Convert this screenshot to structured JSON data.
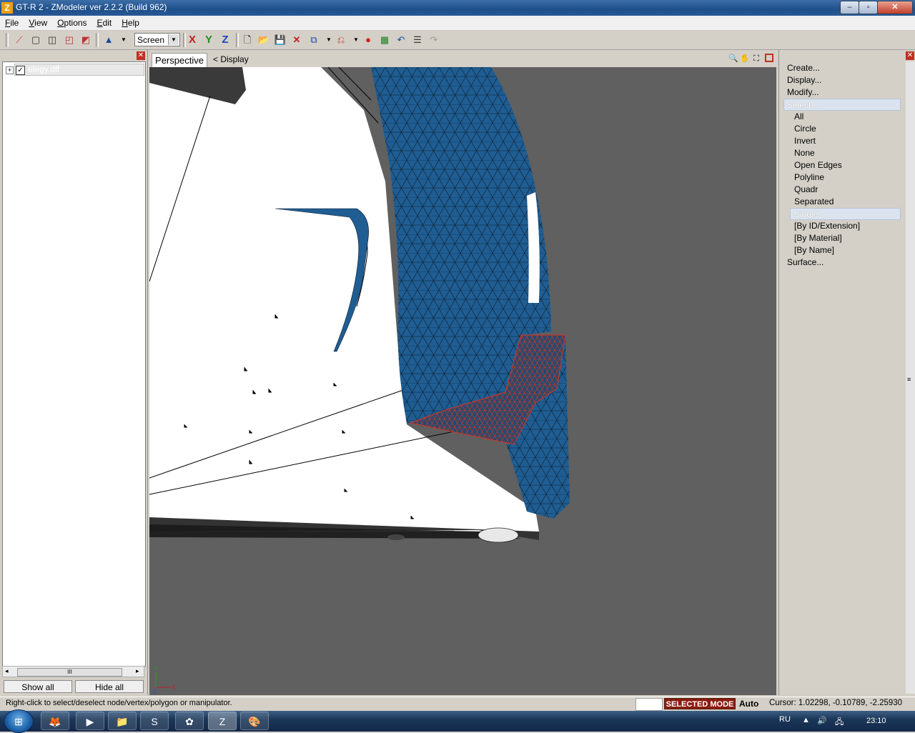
{
  "window": {
    "title": "GT-R 2 - ZModeler ver 2.2.2 (Build 962)",
    "controls": {
      "minimize": "‒",
      "maximize": "▫",
      "close": "✕"
    }
  },
  "menu": [
    "File",
    "View",
    "Options",
    "Edit",
    "Help"
  ],
  "toolbar": {
    "screen_select": "Screen",
    "axis_x": "X",
    "axis_y": "Y",
    "axis_z": "Z"
  },
  "left_panel": {
    "tree": [
      {
        "label": "elegy.dff",
        "checked": true,
        "expander": "+"
      }
    ],
    "check_mark": "✓",
    "show_all": "Show all",
    "hide_all": "Hide all",
    "scroll_grip": "III"
  },
  "viewport": {
    "tab": "Perspective",
    "breadcrumb": "<   Display",
    "axis_y": "Y",
    "axis_x": "X",
    "axis_z": "Z",
    "colors": {
      "background": "#606060",
      "mesh": "#1f5d92",
      "selection": "#c0392b"
    }
  },
  "right_panel": {
    "commands": [
      {
        "label": "Create...",
        "level": 0,
        "selected": false
      },
      {
        "label": "Display...",
        "level": 0,
        "selected": false
      },
      {
        "label": "Modify...",
        "level": 0,
        "selected": false
      },
      {
        "label": "Select...",
        "level": 0,
        "selected": true
      },
      {
        "label": "All",
        "level": 1,
        "selected": false
      },
      {
        "label": "Circle",
        "level": 1,
        "selected": false
      },
      {
        "label": "Invert",
        "level": 1,
        "selected": false
      },
      {
        "label": "None",
        "level": 1,
        "selected": false
      },
      {
        "label": "Open Edges",
        "level": 1,
        "selected": false
      },
      {
        "label": "Polyline",
        "level": 1,
        "selected": false
      },
      {
        "label": "Quadr",
        "level": 1,
        "selected": false
      },
      {
        "label": "Separated",
        "level": 1,
        "selected": false
      },
      {
        "label": "Single",
        "level": 1,
        "selected": true
      },
      {
        "label": "[By ID/Extension]",
        "level": 1,
        "selected": false
      },
      {
        "label": "[By Material]",
        "level": 1,
        "selected": false
      },
      {
        "label": "[By Name]",
        "level": 1,
        "selected": false
      },
      {
        "label": "Surface...",
        "level": 0,
        "selected": false
      }
    ]
  },
  "status": {
    "hint": "Right-click to select/deselect node/vertex/polygon or manipulator.",
    "mode": "SELECTED MODE",
    "auto": "Auto",
    "cursor": "Cursor: 1.02298, -0.10789, -2.25930"
  },
  "taskbar": {
    "language": "RU",
    "clock": "23:10",
    "apps": [
      "firefox-icon",
      "media-player-icon",
      "explorer-icon",
      "skype-icon",
      "app-icon",
      "zmodeler-icon",
      "paint-icon"
    ]
  }
}
